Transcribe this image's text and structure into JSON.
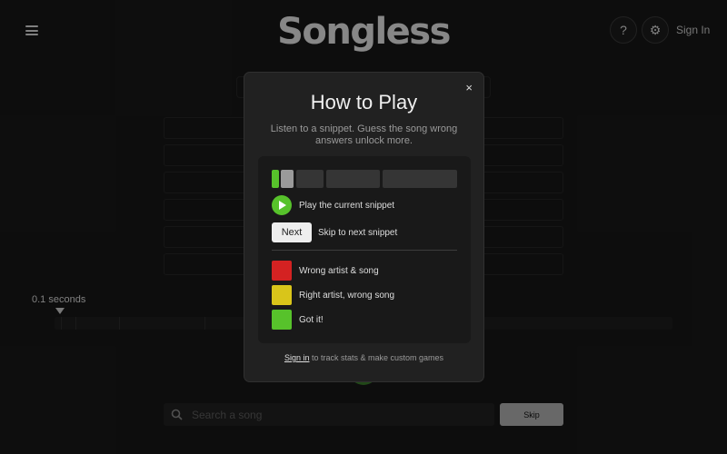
{
  "header": {
    "logo": "Songless",
    "help_symbol": "?",
    "settings_symbol": "⚙",
    "sign_in": "Sign In"
  },
  "game": {
    "time_label": "0.1 seconds",
    "search_placeholder": "Search a song",
    "skip_label": "Skip"
  },
  "modal": {
    "title": "How to Play",
    "subtitle": "Listen to a snippet. Guess the song wrong answers unlock more.",
    "close_symbol": "×",
    "play_text": "Play the current snippet",
    "next_button": "Next",
    "next_text": "Skip to next snippet",
    "legend": [
      {
        "color": "#d42222",
        "label": "Wrong artist & song"
      },
      {
        "color": "#d9c51a",
        "label": "Right artist, wrong song"
      },
      {
        "color": "#57c22b",
        "label": "Got it!"
      }
    ],
    "footer_link": "Sign in",
    "footer_text": " to track stats & make custom games"
  },
  "colors": {
    "accent_green": "#57c22b",
    "background": "#181818"
  },
  "icons": [
    "menu-icon",
    "help-icon",
    "settings-icon",
    "close-icon",
    "play-icon",
    "search-icon"
  ]
}
